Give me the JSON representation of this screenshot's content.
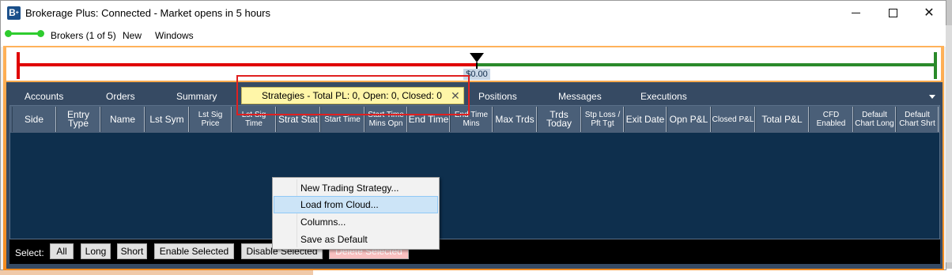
{
  "window": {
    "title": "Brokerage Plus: Connected - Market opens in 5 hours",
    "app_icon_letter": "B",
    "controls": {
      "minimize": "minimize",
      "maximize": "maximize",
      "close": "✕"
    }
  },
  "menu": {
    "items": [
      "Brokers (1 of 5)",
      "New",
      "Windows"
    ],
    "connection_color": "#2ecc2e"
  },
  "pnl_bar": {
    "value_label": "$0.00",
    "negative_color": "#e00000",
    "positive_color": "#2a8a2a"
  },
  "tabs": {
    "items": [
      "Accounts",
      "Orders",
      "Summary",
      "Positions",
      "Messages",
      "Executions"
    ],
    "active": "Strategies - Total PL: 0, Open: 0, Closed: 0",
    "active_close": "✕",
    "active_color": "#fff6a8"
  },
  "grid": {
    "columns": [
      "Side",
      "Entry Type",
      "Name",
      "Lst Sym",
      "Lst Sig Price",
      "Lst Sig Time",
      "Strat Stat",
      "Start Time",
      "Start Time Mins Opn",
      "End Time",
      "End Time Mins",
      "Max Trds",
      "Trds Today",
      "Stp Loss / Pft Tgt",
      "Exit Date",
      "Opn P&L",
      "Closed P&L",
      "Total P&L",
      "CFD Enabled",
      "Default Chart Long",
      "Default Chart Shrt"
    ],
    "rows": []
  },
  "select_bar": {
    "label": "Select:",
    "buttons": [
      "All",
      "Long",
      "Short",
      "Enable Selected",
      "Disable Selected",
      "Delete Selected"
    ]
  },
  "context_menu": {
    "items": [
      "New Trading Strategy...",
      "Load from Cloud...",
      "Columns...",
      "Save as Default"
    ],
    "highlighted": "Load from Cloud..."
  }
}
